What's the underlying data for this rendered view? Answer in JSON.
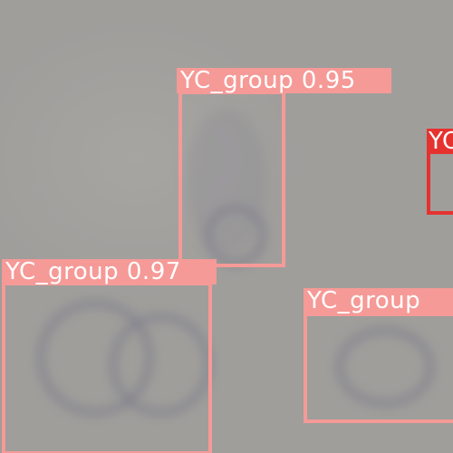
{
  "image": {
    "description_colors": {
      "background": "#9f9e9b",
      "box_pink": "#f59a97",
      "box_red": "#e5322f",
      "label_text": "#ffffff"
    }
  },
  "detections": [
    {
      "label": "YC_group 0.95",
      "confidence": 0.95,
      "color": "#f59a97"
    },
    {
      "label": "YC_group 0.97",
      "confidence": 0.97,
      "color": "#f59a97"
    },
    {
      "label": "YC_group",
      "confidence": null,
      "color": "#f59a97"
    },
    {
      "label": "YC",
      "confidence": null,
      "color": "#e5322f"
    }
  ]
}
